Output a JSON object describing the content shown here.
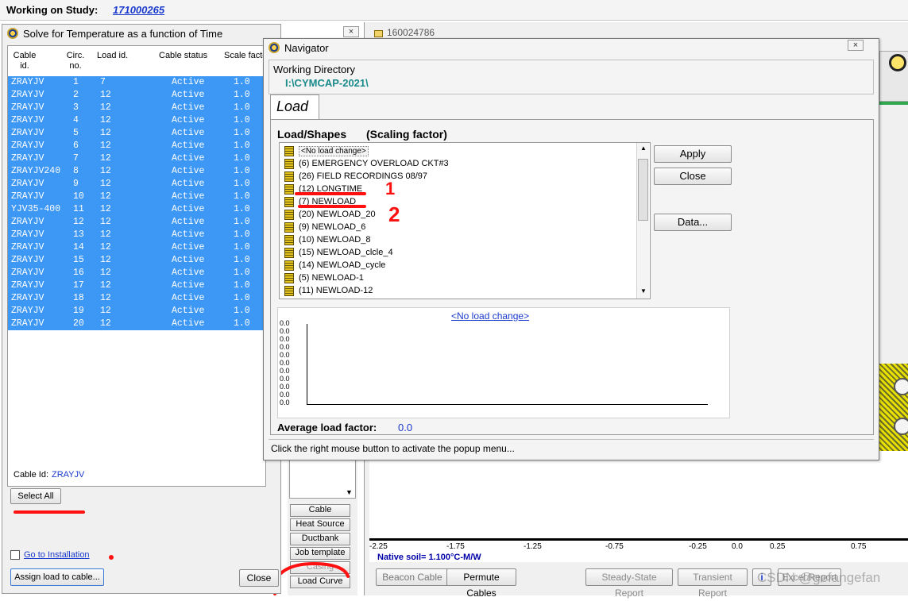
{
  "study": {
    "label": "Working on Study:",
    "id": "171000265"
  },
  "solve_window": {
    "title": "Solve for Temperature as a function of Time",
    "columns": [
      "Cable id.",
      "Circ. no.",
      "Load id.",
      "Cable status",
      "Scale facto"
    ],
    "rows": [
      [
        "ZRAYJV",
        "1",
        "7",
        "Active",
        "1.0"
      ],
      [
        "ZRAYJV",
        "2",
        "12",
        "Active",
        "1.0"
      ],
      [
        "ZRAYJV",
        "3",
        "12",
        "Active",
        "1.0"
      ],
      [
        "ZRAYJV",
        "4",
        "12",
        "Active",
        "1.0"
      ],
      [
        "ZRAYJV",
        "5",
        "12",
        "Active",
        "1.0"
      ],
      [
        "ZRAYJV",
        "6",
        "12",
        "Active",
        "1.0"
      ],
      [
        "ZRAYJV",
        "7",
        "12",
        "Active",
        "1.0"
      ],
      [
        "ZRAYJV240",
        "8",
        "12",
        "Active",
        "1.0"
      ],
      [
        "ZRAYJV",
        "9",
        "12",
        "Active",
        "1.0"
      ],
      [
        "ZRAYJV",
        "10",
        "12",
        "Active",
        "1.0"
      ],
      [
        "YJV35-400",
        "11",
        "12",
        "Active",
        "1.0"
      ],
      [
        "ZRAYJV",
        "12",
        "12",
        "Active",
        "1.0"
      ],
      [
        "ZRAYJV",
        "13",
        "12",
        "Active",
        "1.0"
      ],
      [
        "ZRAYJV",
        "14",
        "12",
        "Active",
        "1.0"
      ],
      [
        "ZRAYJV",
        "15",
        "12",
        "Active",
        "1.0"
      ],
      [
        "ZRAYJV",
        "16",
        "12",
        "Active",
        "1.0"
      ],
      [
        "ZRAYJV",
        "17",
        "12",
        "Active",
        "1.0"
      ],
      [
        "ZRAYJV",
        "18",
        "12",
        "Active",
        "1.0"
      ],
      [
        "ZRAYJV",
        "19",
        "12",
        "Active",
        "1.0"
      ],
      [
        "ZRAYJV",
        "20",
        "12",
        "Active",
        "1.0"
      ]
    ],
    "cable_id_label": "Cable Id:",
    "cable_id_value": "ZRAYJV",
    "select_all": "Select All",
    "go_to_installation": "Go to Installation",
    "assign_load": "Assign load to cable...",
    "close": "Close"
  },
  "background_tab": {
    "title": "160024786"
  },
  "side_buttons": [
    "Cable",
    "Heat Source",
    "Ductbank",
    "Job template",
    "Casing",
    "Load Curve"
  ],
  "navigator": {
    "title": "Navigator",
    "working_dir_label": "Working Directory",
    "working_dir_value": "I:\\CYMCAP-2021\\",
    "tab": "Load",
    "shapes_label": "Load/Shapes",
    "scaling_label": "(Scaling factor)",
    "items": [
      "<No load change>",
      "(6) EMERGENCY OVERLOAD CKT#3",
      "(26) FIELD RECORDINGS 08/97",
      "(12) LONGTIME",
      "(7) NEWLOAD",
      "(20) NEWLOAD_20",
      "(9) NEWLOAD_6",
      "(10) NEWLOAD_8",
      "(15) NEWLOAD_clcle_4",
      "(14) NEWLOAD_cycle",
      "(5) NEWLOAD-1",
      "(11) NEWLOAD-12"
    ],
    "apply": "Apply",
    "close": "Close",
    "data": "Data...",
    "chart_title": "<No load change>",
    "y_ticks": [
      "0.0",
      "0.0",
      "0.0",
      "0.0",
      "0.0",
      "0.0",
      "0.0",
      "0.0",
      "0.0",
      "0.0",
      "0.0"
    ],
    "avg_label": "Average load factor:",
    "avg_value": "0.0",
    "status": "Click the right mouse button to activate the popup menu..."
  },
  "chart_data": {
    "type": "line",
    "title": "<No load change>",
    "y_ticks": [
      "0.0",
      "0.0",
      "0.0",
      "0.0",
      "0.0",
      "0.0",
      "0.0",
      "0.0",
      "0.0",
      "0.0",
      "0.0"
    ],
    "series": []
  },
  "installation": {
    "x_ticks": [
      "-2.25",
      "-1.75",
      "-1.25",
      "-0.75",
      "-0.25",
      "0.0",
      "0.25",
      "0.75"
    ],
    "native_soil": "Native soil= 1.100°C-M/W"
  },
  "bottom_buttons": {
    "beacon": "Beacon Cable",
    "permute": "Permute Cables",
    "steady": "Steady-State Report",
    "transient": "Transient Report",
    "excel": "Excel Report"
  },
  "watermark": "CSDN @gefangefan",
  "annotations": {
    "mark1": "1",
    "mark2": "2"
  },
  "colors": {
    "selection": "#3d97f4",
    "accent_text": "#1a8a8a",
    "link": "#0000cc",
    "marker": "#ff1010"
  }
}
